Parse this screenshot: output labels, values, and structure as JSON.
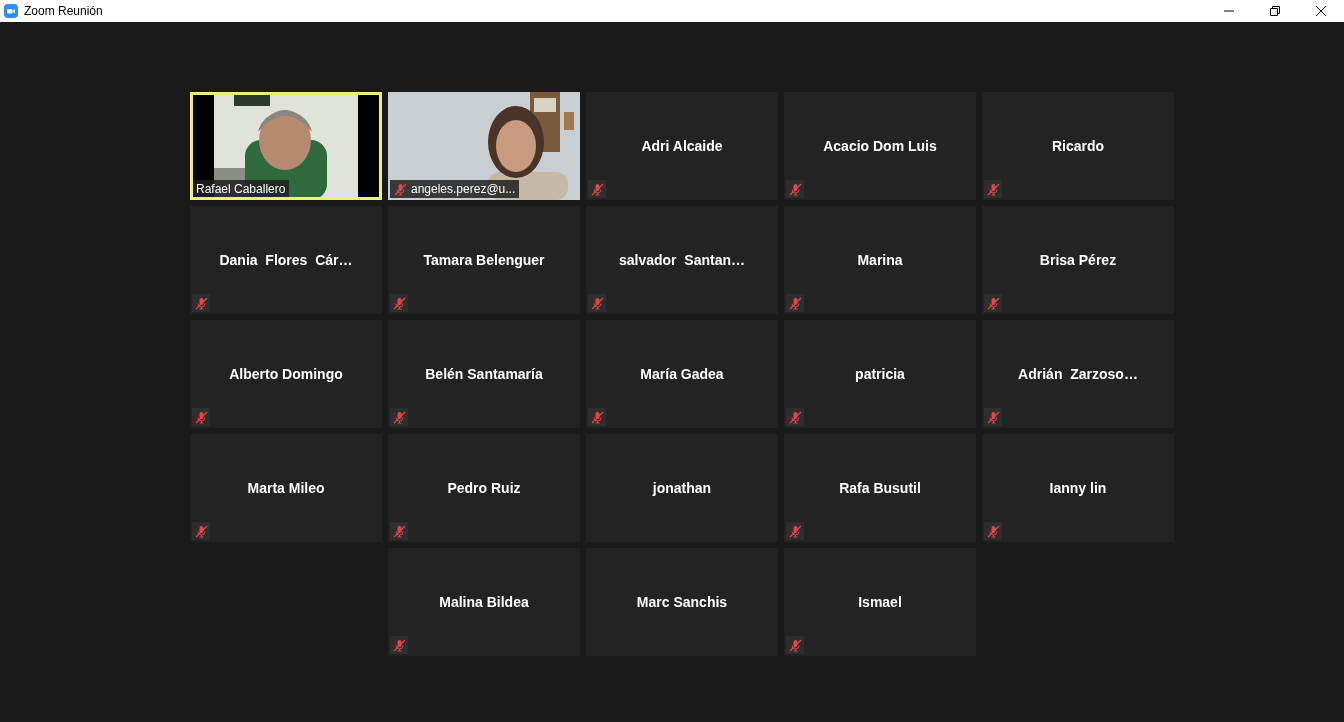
{
  "window": {
    "title": "Zoom Reunión"
  },
  "participants": [
    {
      "name": "Rafael Caballero",
      "kind": "video",
      "muted": false,
      "selected": true
    },
    {
      "name": "angeles.perez@u...",
      "kind": "video",
      "muted": true,
      "selected": false
    },
    {
      "name": "Adri Alcaide",
      "kind": "name",
      "muted": true,
      "selected": false
    },
    {
      "name": "Acacio Dom Luis",
      "kind": "name",
      "muted": true,
      "selected": false
    },
    {
      "name": "Ricardo",
      "kind": "name",
      "muted": true,
      "selected": false
    },
    {
      "name": "Dania  Flores  Cár…",
      "kind": "name",
      "muted": true,
      "selected": false
    },
    {
      "name": "Tamara Belenguer",
      "kind": "name",
      "muted": true,
      "selected": false
    },
    {
      "name": "salvador  Santan…",
      "kind": "name",
      "muted": true,
      "selected": false
    },
    {
      "name": "Marina",
      "kind": "name",
      "muted": true,
      "selected": false
    },
    {
      "name": "Brisa Pérez",
      "kind": "name",
      "muted": true,
      "selected": false
    },
    {
      "name": "Alberto Domingo",
      "kind": "name",
      "muted": true,
      "selected": false
    },
    {
      "name": "Belén Santamaría",
      "kind": "name",
      "muted": true,
      "selected": false
    },
    {
      "name": "María Gadea",
      "kind": "name",
      "muted": true,
      "selected": false
    },
    {
      "name": "patricia",
      "kind": "name",
      "muted": true,
      "selected": false
    },
    {
      "name": "Adrián  Zarzoso…",
      "kind": "name",
      "muted": true,
      "selected": false
    },
    {
      "name": "Marta Mileo",
      "kind": "name",
      "muted": true,
      "selected": false
    },
    {
      "name": "Pedro Ruiz",
      "kind": "name",
      "muted": true,
      "selected": false
    },
    {
      "name": "jonathan",
      "kind": "name",
      "muted": false,
      "selected": false
    },
    {
      "name": "Rafa Busutil",
      "kind": "name",
      "muted": true,
      "selected": false
    },
    {
      "name": "Ianny lin",
      "kind": "name",
      "muted": true,
      "selected": false
    },
    {
      "name": "Malina Bildea",
      "kind": "name",
      "muted": true,
      "selected": false
    },
    {
      "name": "Marc Sanchis",
      "kind": "name",
      "muted": false,
      "selected": false
    },
    {
      "name": "Ismael",
      "kind": "name",
      "muted": true,
      "selected": false
    }
  ]
}
